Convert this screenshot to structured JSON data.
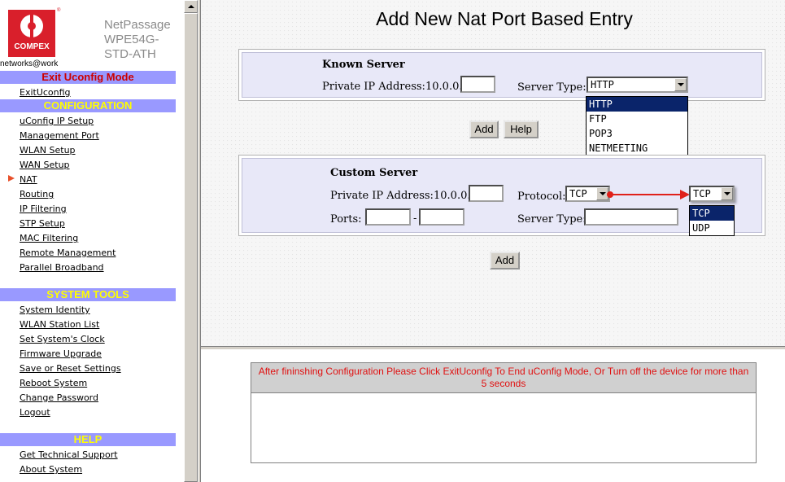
{
  "brand": {
    "logo_text": "COMPEX",
    "reg_mark": "®",
    "tagline": "networks@work",
    "product_lines": [
      "NetPassage",
      "WPE54G-",
      "STD-ATH"
    ]
  },
  "sidebar": {
    "exit_header": "Exit Uconfig Mode",
    "exit_link": "ExitUconfig",
    "config_header": "CONFIGURATION",
    "config_items": [
      "uConfig IP Setup",
      "Management Port",
      "WLAN Setup",
      "WAN Setup",
      "NAT",
      "Routing",
      "IP Filtering",
      "STP Setup",
      "MAC Filtering",
      "Remote Management",
      "Parallel Broadband"
    ],
    "tools_header": "SYSTEM TOOLS",
    "tools_items": [
      "System Identity",
      "WLAN Station List",
      "Set System's Clock",
      "Firmware Upgrade",
      "Save or Reset Settings",
      "Reboot System",
      "Change Password",
      "Logout"
    ],
    "help_header": "HELP",
    "help_items": [
      "Get Technical Support",
      "About System"
    ],
    "active_item": "NAT"
  },
  "main": {
    "title": "Add New Nat Port Based Entry",
    "known_server": {
      "heading": "Known Server",
      "ip_label": "Private IP Address:",
      "ip_prefix": "10.0.0.",
      "ip_value": "",
      "server_type_label": "Server Type:",
      "server_type_value": "HTTP",
      "server_type_options": [
        "HTTP",
        "FTP",
        "POP3",
        "NETMEETING"
      ],
      "add_label": "Add",
      "help_label": "Help"
    },
    "custom_server": {
      "heading": "Custom Server",
      "ip_label": "Private IP Address:",
      "ip_prefix": "10.0.0.",
      "ip_value": "",
      "protocol_label": "Protocol:",
      "protocol_value": "TCP",
      "protocol_expanded_value": "TCP",
      "protocol_options": [
        "TCP",
        "UDP"
      ],
      "ports_label": "Ports:",
      "ports_sep": "-",
      "server_type_label": "Server Type:",
      "server_type_value": "",
      "add_label": "Add"
    }
  },
  "bottom": {
    "message": "After fininshing Configuration Please Click ExitUconfig To End uConfig Mode, Or Turn off the device for more than 5 seconds"
  },
  "colors": {
    "section_header_bg": "#9999ff",
    "section_header_text": "#ffff00",
    "exit_header_text": "#cc0000",
    "logo_red": "#d91f2b",
    "annotation_arrow": "#e0201a",
    "message_text": "#e01010",
    "dropdown_highlight": "#0a246a"
  }
}
